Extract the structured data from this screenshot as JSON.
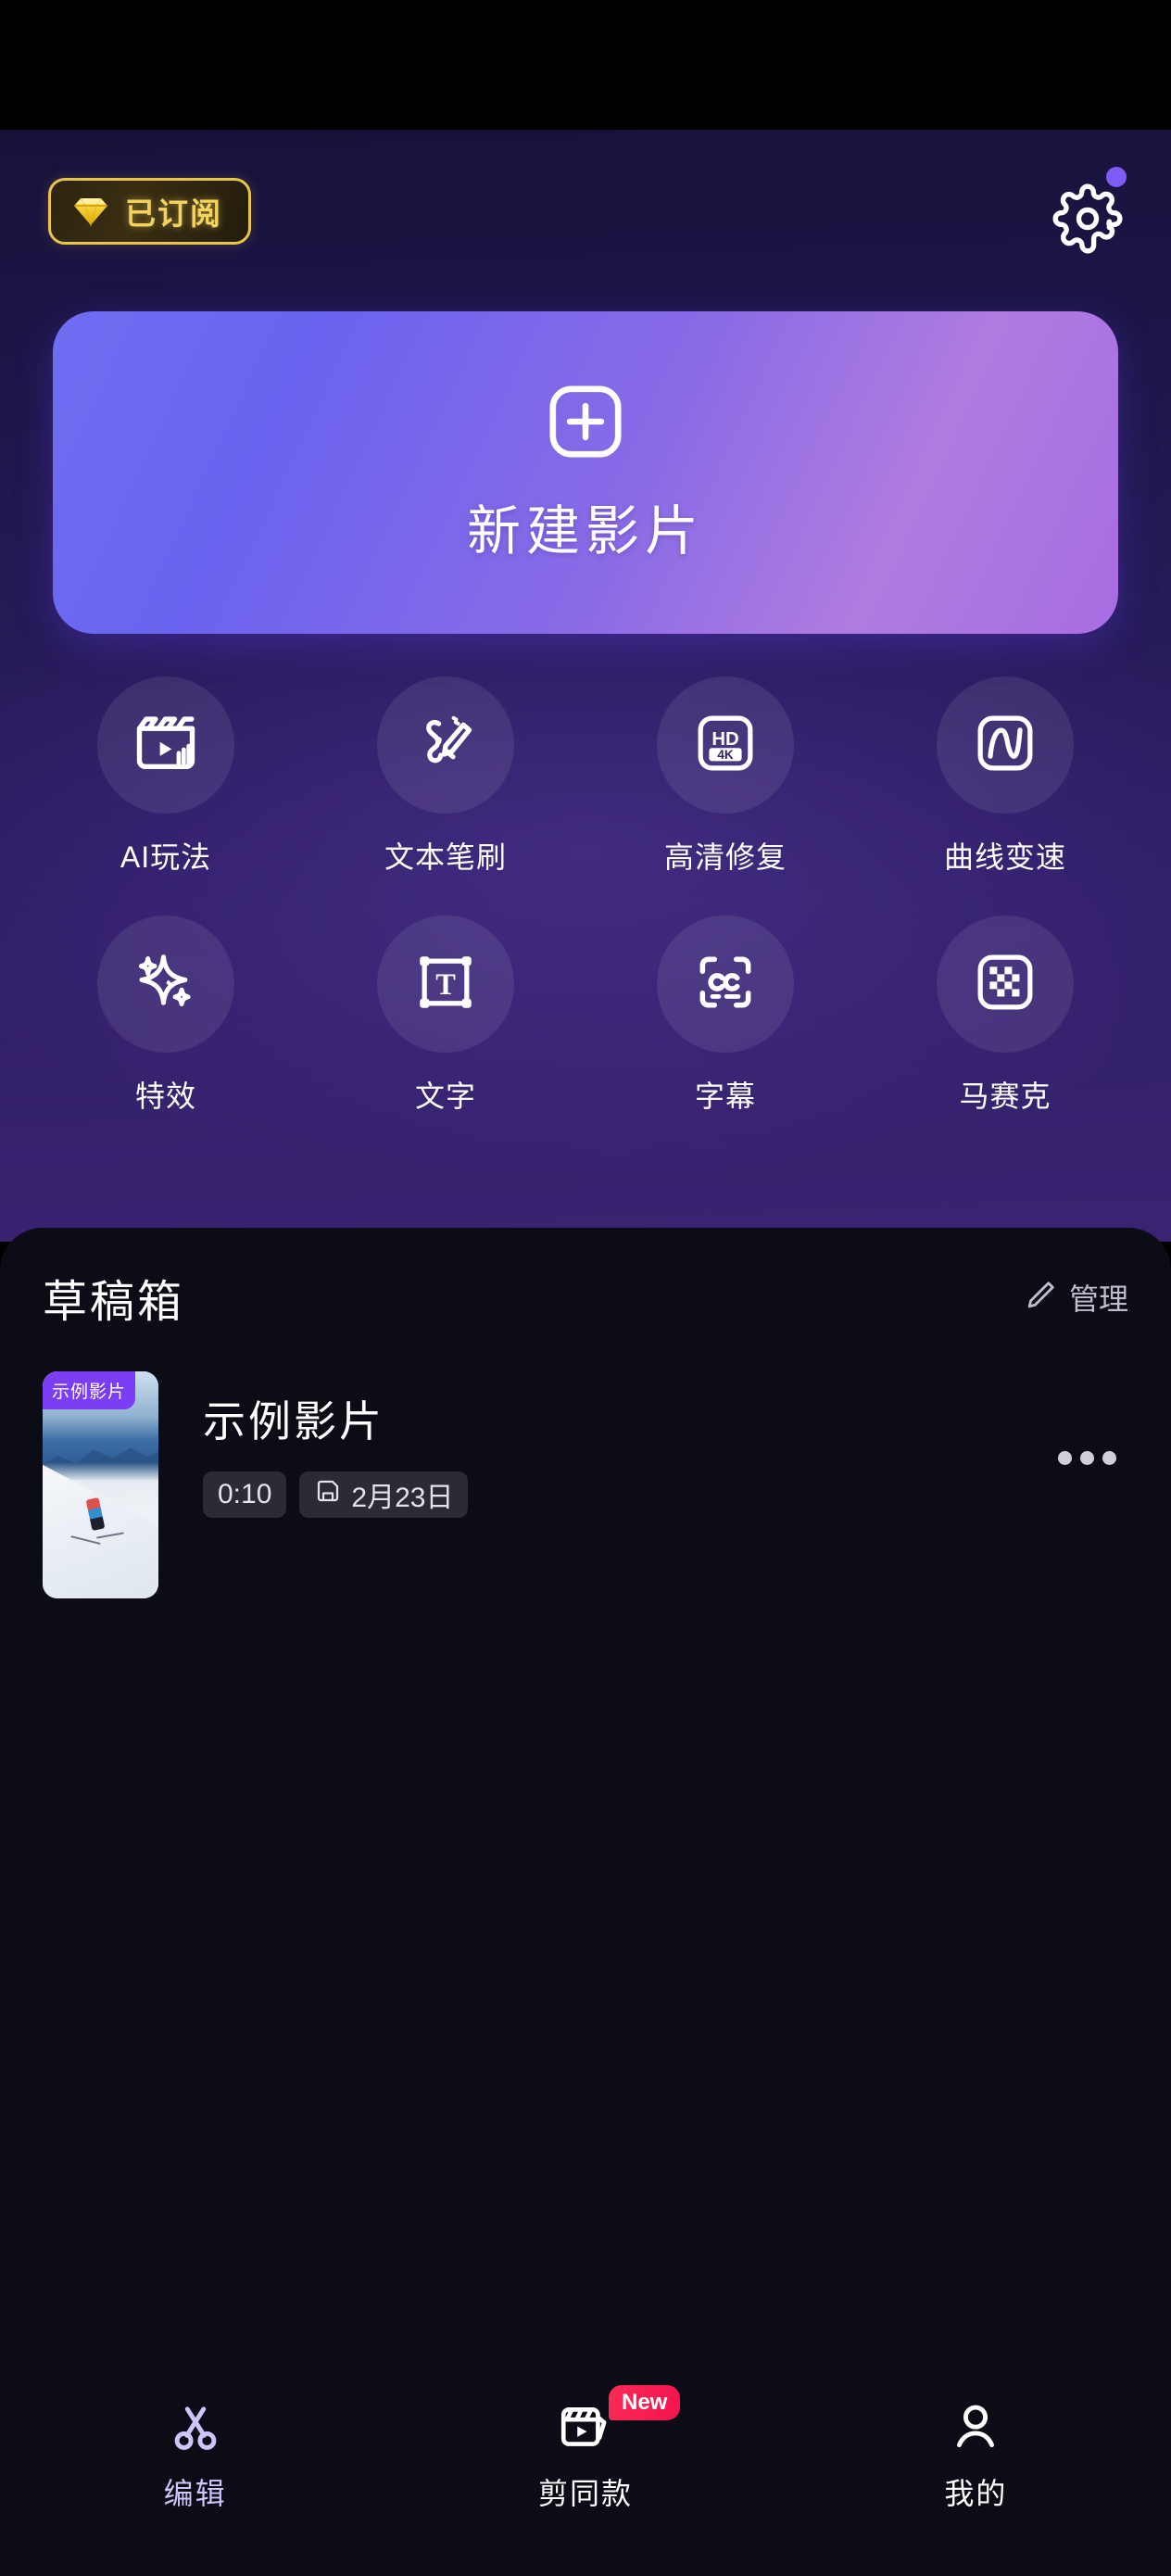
{
  "header": {
    "subscription_badge": {
      "label": "已订阅",
      "icon": "diamond-icon",
      "border_color": "#e8c54a",
      "text_color": "#f3d35e"
    },
    "settings_icon": "gear-icon",
    "notification_dot_color": "#7c5cf5"
  },
  "cta": {
    "label": "新建影片",
    "icon": "plus-square-icon",
    "gradient_from": "#6f6ef2",
    "gradient_to": "#a76ce2"
  },
  "features": [
    {
      "label": "AI玩法",
      "icon": "clapperboard-play-icon"
    },
    {
      "label": "文本笔刷",
      "icon": "paintbrush-icon"
    },
    {
      "label": "高清修复",
      "icon": "hd-4k-icon"
    },
    {
      "label": "曲线变速",
      "icon": "speed-curve-icon"
    },
    {
      "label": "特效",
      "icon": "sparkle-icon"
    },
    {
      "label": "文字",
      "icon": "text-box-icon"
    },
    {
      "label": "字幕",
      "icon": "closed-caption-icon"
    },
    {
      "label": "马赛克",
      "icon": "mosaic-icon"
    }
  ],
  "drafts": {
    "title": "草稿箱",
    "manage": {
      "label": "管理",
      "icon": "pencil-icon"
    },
    "items": [
      {
        "badge": "示例影片",
        "name": "示例影片",
        "duration": "0:10",
        "date": "2月23日",
        "date_icon": "save-disk-icon",
        "more_icon": "more-horizontal-icon"
      }
    ]
  },
  "bottom_nav": {
    "active_color": "#cdc6fb",
    "items": [
      {
        "label": "编辑",
        "icon": "scissors-icon",
        "active": true,
        "badge": ""
      },
      {
        "label": "剪同款",
        "icon": "template-video-icon",
        "active": false,
        "badge": "New"
      },
      {
        "label": "我的",
        "icon": "person-icon",
        "active": false,
        "badge": ""
      }
    ]
  }
}
